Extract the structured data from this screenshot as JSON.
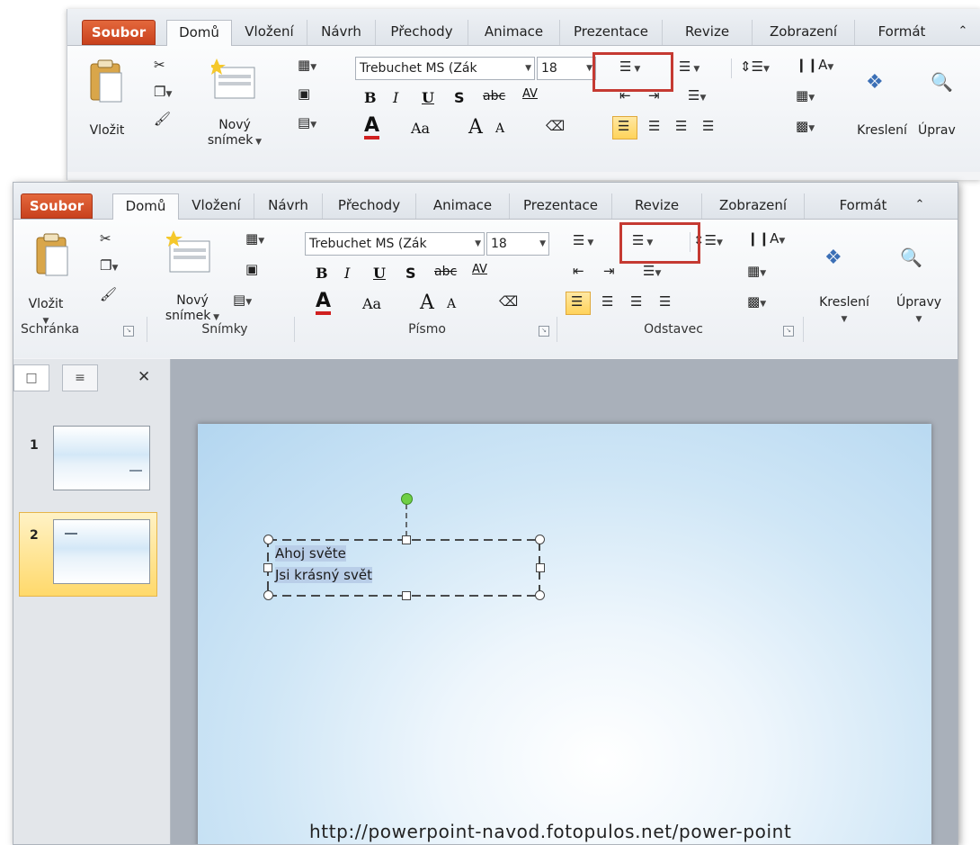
{
  "tabs": {
    "file": "Soubor",
    "home": "Domů",
    "insert": "Vložení",
    "design": "Návrh",
    "transitions": "Přechody",
    "animations": "Animace",
    "presentation": "Prezentace",
    "review": "Revize",
    "view": "Zobrazení",
    "format": "Formát",
    "collapse": "⌃"
  },
  "ribbon": {
    "paste": "Vložit",
    "new_slide_1": "Nový",
    "new_slide_2": "snímek",
    "font_name": "Trebuchet MS (Zák",
    "font_size": "18",
    "bold": "B",
    "italic": "I",
    "underline": "U",
    "shadow": "S",
    "strike": "abc",
    "spacing": "AV",
    "font_color": "A",
    "change_case": "Aa",
    "grow": "A",
    "shrink": "A",
    "draw": "Kreslení",
    "editing": "Úpravy",
    "editing_cut": "Úprav"
  },
  "groups": {
    "clipboard": "Schránka",
    "slides": "Snímky",
    "font": "Písmo",
    "paragraph": "Odstavec"
  },
  "slides": {
    "thumb1": "1",
    "thumb2": "2"
  },
  "textbox": {
    "line1": "Ahoj světe",
    "line2": "Jsi krásný svět"
  },
  "caption": "http://powerpoint-navod.fotopulos.net/power-point",
  "colors": {
    "file_tab": "#d2502a",
    "highlight": "#c53a32",
    "selection": "#b9cee8",
    "rotate_handle": "#6fcf45"
  }
}
